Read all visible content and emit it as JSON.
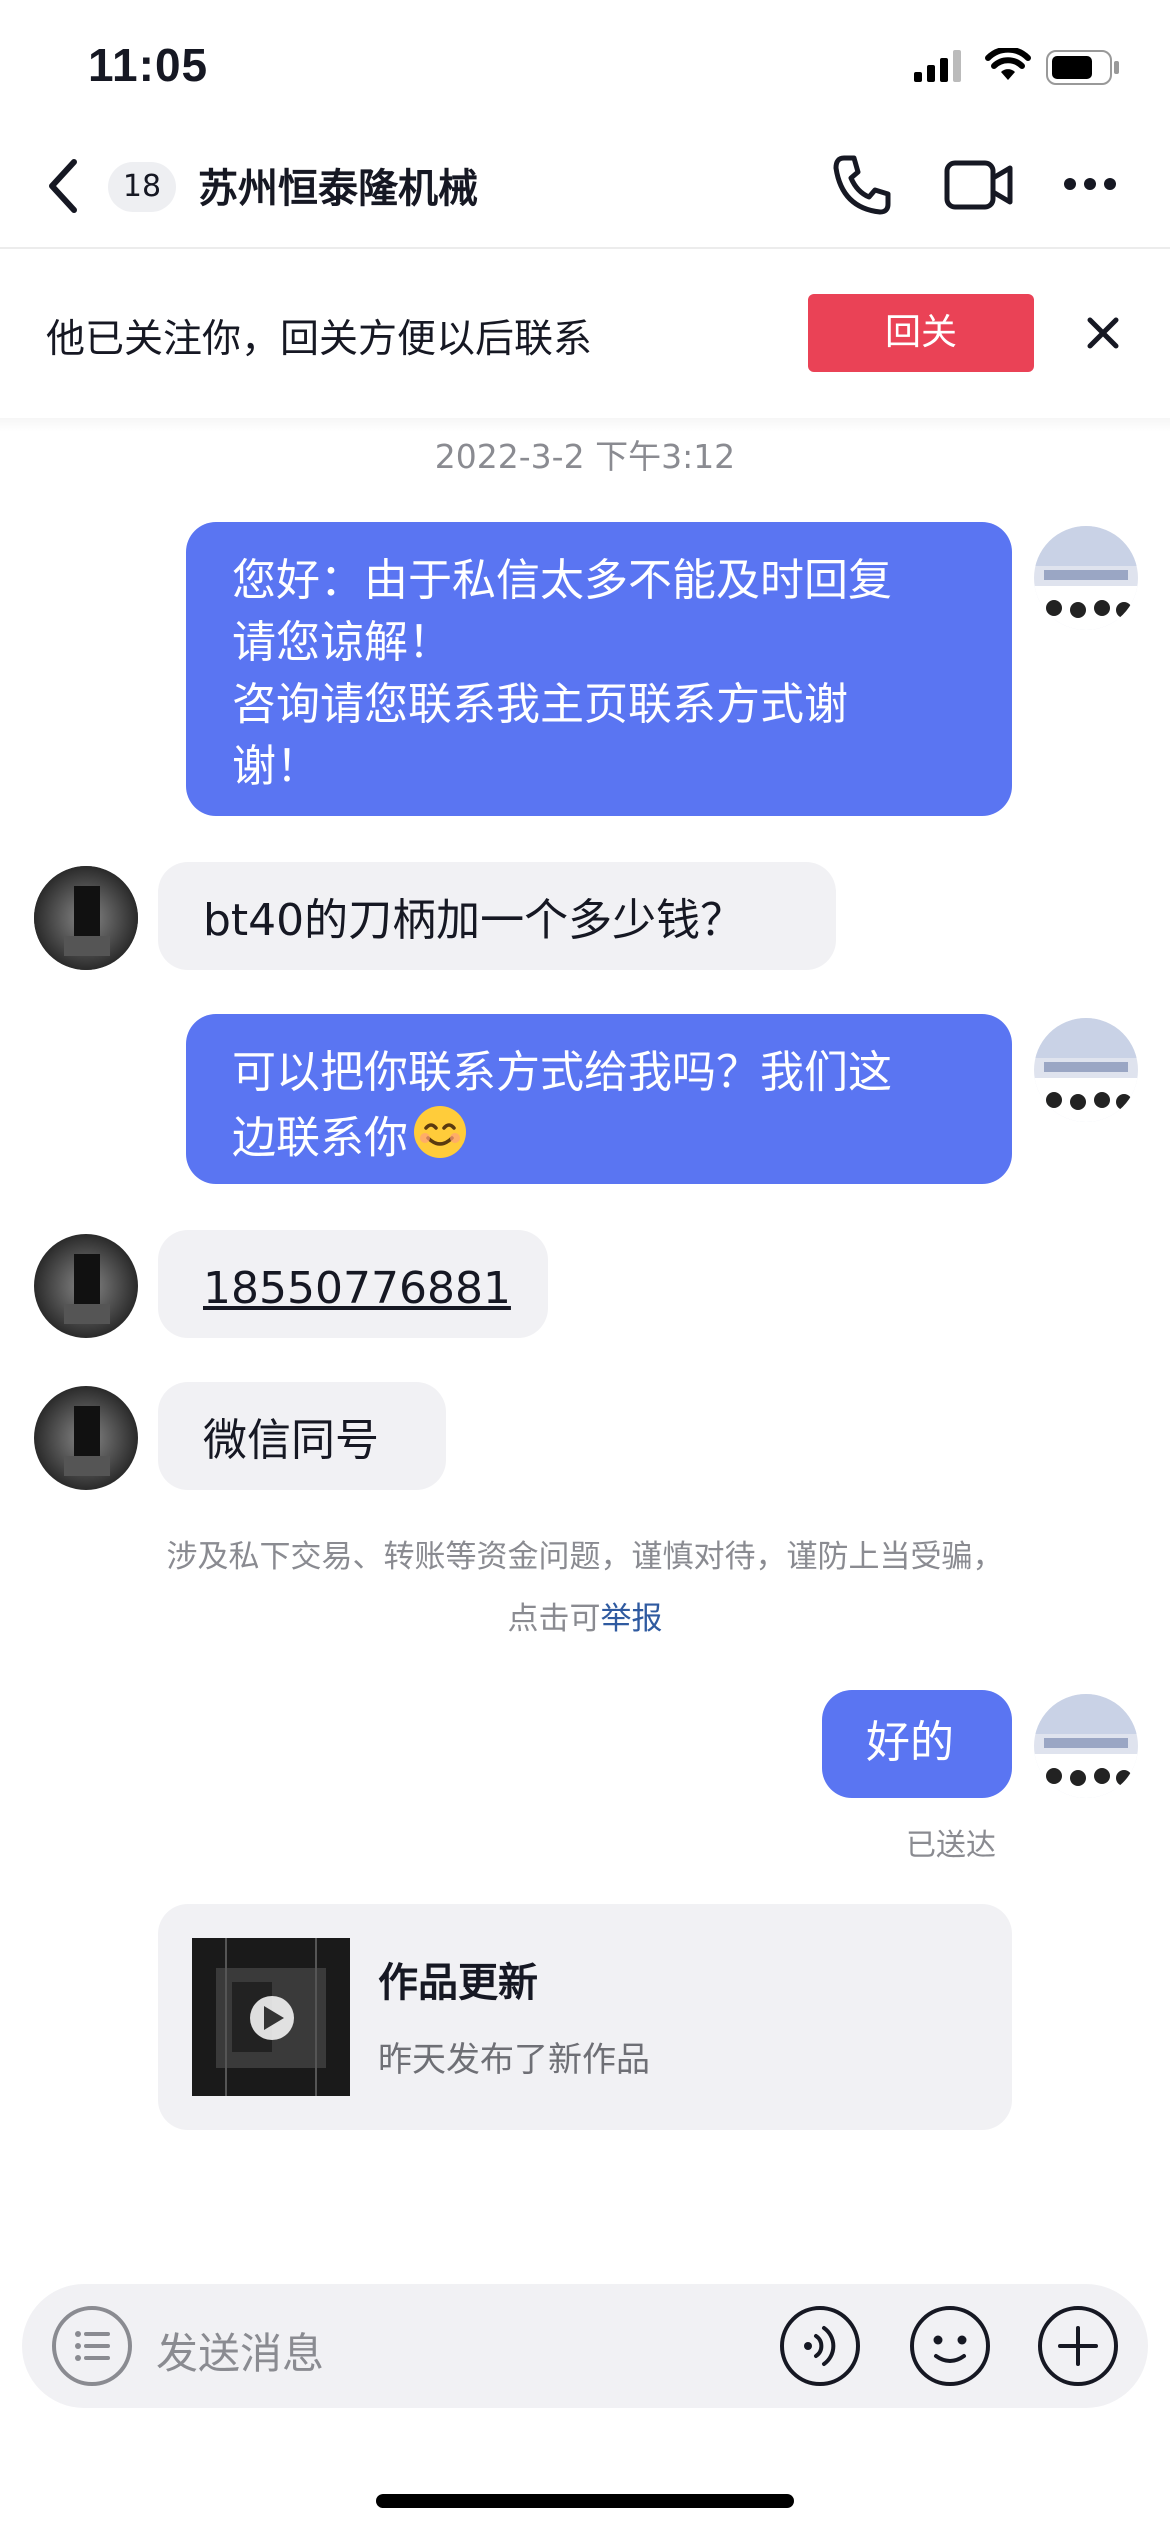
{
  "status_bar": {
    "time": "11:05"
  },
  "nav": {
    "unread_count": "18",
    "title": "苏州恒泰隆机械"
  },
  "follow_banner": {
    "text": "他已关注你，回关方便以后联系",
    "button_label": "回关"
  },
  "timestamp": "2022-3-2 下午3:12",
  "messages": [
    {
      "side": "out",
      "lines": [
        "您好：由于私信太多不能及时回复",
        "请您谅解！",
        "咨询请您联系我主页联系方式谢",
        "谢！"
      ]
    },
    {
      "side": "in",
      "text": "bt40的刀柄加一个多少钱？"
    },
    {
      "side": "out",
      "lines": [
        "可以把你联系方式给我吗？我们这",
        "边联系你"
      ],
      "emoji": "😊"
    },
    {
      "side": "in",
      "text": "18550776881"
    },
    {
      "side": "in",
      "text": "微信同号"
    },
    {
      "side": "out",
      "text": "好的"
    }
  ],
  "safety_notice": {
    "line1": "涉及私下交易、转账等资金问题，谨慎对待，谨防上当受骗，",
    "line2_prefix": "点击可",
    "line2_link": "举报"
  },
  "delivered": "已送达",
  "works_card": {
    "title": "作品更新",
    "subtitle": "昨天发布了新作品"
  },
  "input": {
    "placeholder": "发送消息"
  },
  "colors": {
    "accent_bubble": "#5a75f2",
    "follow_button": "#ea4256",
    "link": "#2f5aa0"
  }
}
